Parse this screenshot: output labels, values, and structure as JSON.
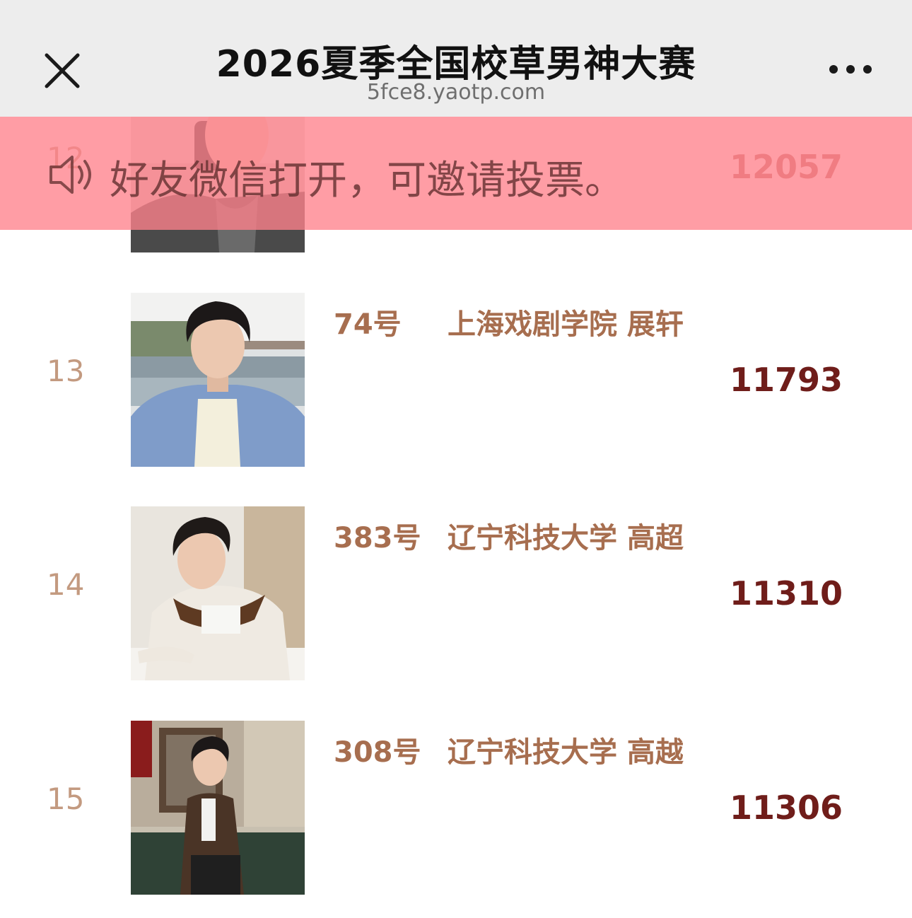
{
  "navbar": {
    "title": "2026夏季全国校草男神大赛",
    "url": "5fce8.yaotp.com",
    "close_icon": "close-icon",
    "more_icon": "more-dots-icon"
  },
  "banner": {
    "icon": "speaker-icon",
    "text": "好友微信打开，可邀请投票。"
  },
  "rows": [
    {
      "rank": "12",
      "entry": "",
      "name": "",
      "votes": "12057"
    },
    {
      "rank": "13",
      "entry": "74号",
      "name": "上海戏剧学院 展轩",
      "votes": "11793"
    },
    {
      "rank": "14",
      "entry": "383号",
      "name": "辽宁科技大学 高超",
      "votes": "11310"
    },
    {
      "rank": "15",
      "entry": "308号",
      "name": "辽宁科技大学 高越",
      "votes": "11306"
    }
  ],
  "colors": {
    "nav_bg": "#ededed",
    "banner_bg": "#ff828c",
    "rank": "#c39a80",
    "entry_text": "#a76e4f",
    "votes": "#6f1d1a"
  }
}
